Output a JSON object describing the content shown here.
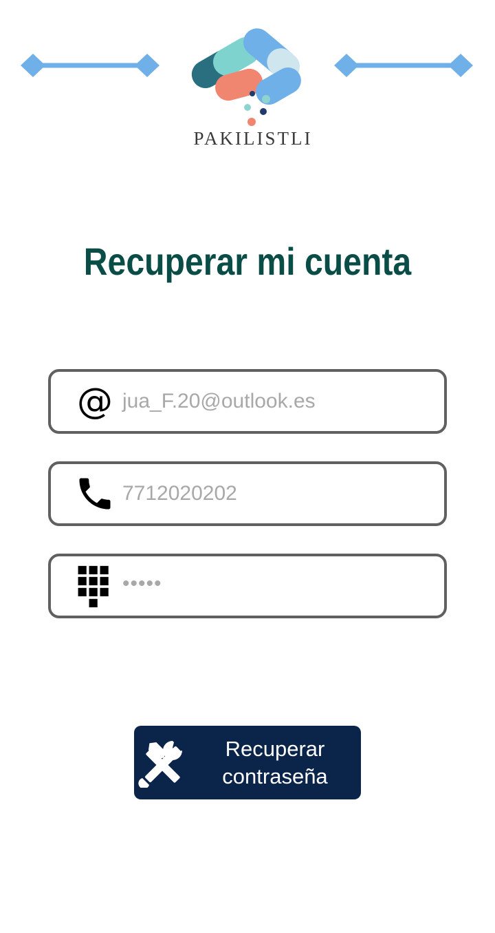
{
  "brand": {
    "name": "PAKILISTLI",
    "accent_color": "#6fb0e8",
    "logo_icon": "pills-logo-icon"
  },
  "title": "Recuperar mi cuenta",
  "title_color": "#0a4d47",
  "fields": {
    "email": {
      "icon": "at-sign-icon",
      "value": "jua_F.20@outlook.es"
    },
    "phone": {
      "icon": "phone-icon",
      "value": "7712020202"
    },
    "code": {
      "icon": "keypad-icon",
      "value": "•••••"
    }
  },
  "recover_button": {
    "icon": "tools-icon",
    "label": "Recuperar\ncontraseña",
    "background": "#0b244a"
  }
}
